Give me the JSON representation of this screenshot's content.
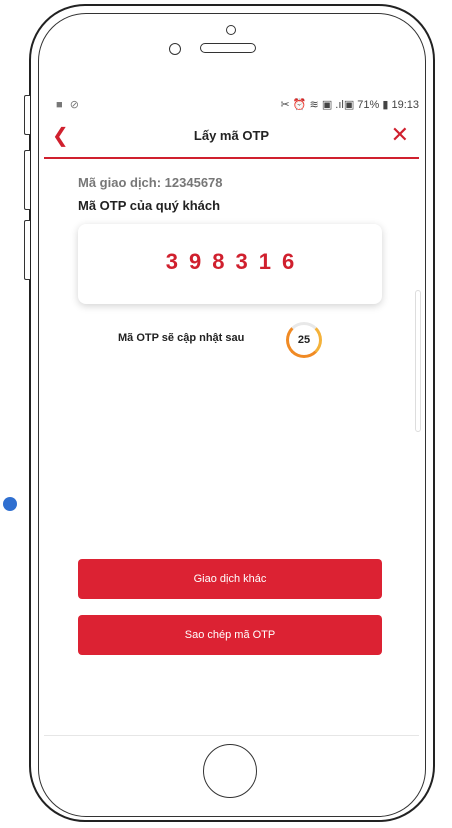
{
  "status_bar": {
    "left_icons": "■ ⊘",
    "right_text": "✂ ⏰ ≋ ▣ .ıl▣ 71% ▮ 19:13"
  },
  "header": {
    "back_icon": "chevron-left-icon",
    "title": "Lấy mã OTP",
    "close_icon": "close-icon"
  },
  "transaction": {
    "label": "Mã giao dịch: 12345678"
  },
  "otp": {
    "label": "Mã OTP của quý khách",
    "code": "398316"
  },
  "timer": {
    "label": "Mã OTP sẽ cập nhật sau",
    "seconds": "25"
  },
  "buttons": {
    "other_transaction": "Giao dịch khác",
    "copy_otp": "Sao chép mã OTP"
  },
  "colors": {
    "accent": "#d0202e",
    "timer": "#f08a24"
  }
}
